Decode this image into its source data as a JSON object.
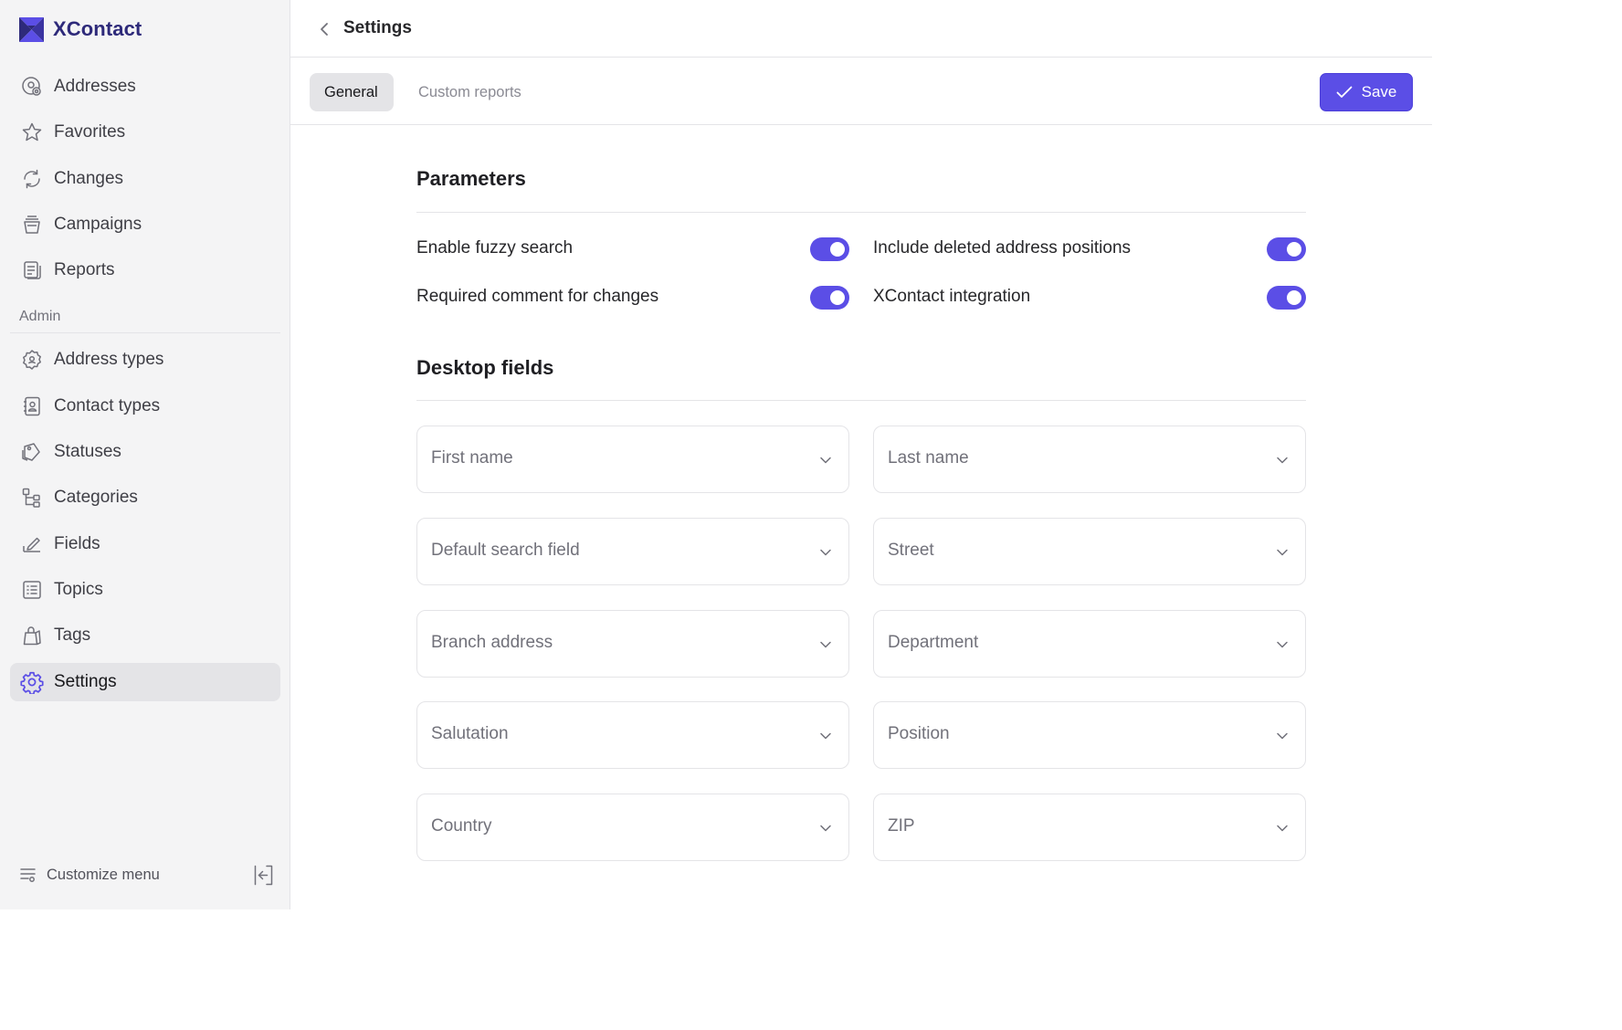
{
  "app": {
    "name": "XContact",
    "logo_icon": "xcontact-logo-icon",
    "accent_color": "#5b4ee6"
  },
  "sidebar": {
    "items": [
      {
        "label": "Addresses",
        "icon": "address-pin-icon"
      },
      {
        "label": "Favorites",
        "icon": "star-icon"
      },
      {
        "label": "Changes",
        "icon": "refresh-icon"
      },
      {
        "label": "Campaigns",
        "icon": "basket-icon"
      },
      {
        "label": "Reports",
        "icon": "report-icon"
      }
    ],
    "admin_label": "Admin",
    "admin_items": [
      {
        "label": "Address types",
        "icon": "badge-icon"
      },
      {
        "label": "Contact types",
        "icon": "contact-book-icon"
      },
      {
        "label": "Statuses",
        "icon": "tag-cards-icon"
      },
      {
        "label": "Categories",
        "icon": "hierarchy-icon"
      },
      {
        "label": "Fields",
        "icon": "edit-field-icon"
      },
      {
        "label": "Topics",
        "icon": "list-icon"
      },
      {
        "label": "Tags",
        "icon": "shopping-bag-icon"
      },
      {
        "label": "Settings",
        "icon": "gear-icon",
        "active": true
      }
    ],
    "customize_label": "Customize menu"
  },
  "header": {
    "title": "Settings"
  },
  "tabs": [
    {
      "label": "General",
      "active": true
    },
    {
      "label": "Custom reports",
      "active": false
    }
  ],
  "toolbar": {
    "save_label": "Save"
  },
  "parameters": {
    "title": "Parameters",
    "items": [
      {
        "label": "Enable fuzzy search",
        "enabled": true
      },
      {
        "label": "Include deleted address positions",
        "enabled": true
      },
      {
        "label": "Required comment for changes",
        "enabled": true
      },
      {
        "label": "XContact integration",
        "enabled": true
      }
    ]
  },
  "desktop_fields": {
    "title": "Desktop fields",
    "selects": [
      {
        "value": "First name"
      },
      {
        "value": "Last name"
      },
      {
        "value": "Default search field"
      },
      {
        "value": "Street"
      },
      {
        "value": "Branch address"
      },
      {
        "value": "Department"
      },
      {
        "value": "Salutation"
      },
      {
        "value": "Position"
      },
      {
        "value": "Country"
      },
      {
        "value": "ZIP"
      }
    ]
  }
}
